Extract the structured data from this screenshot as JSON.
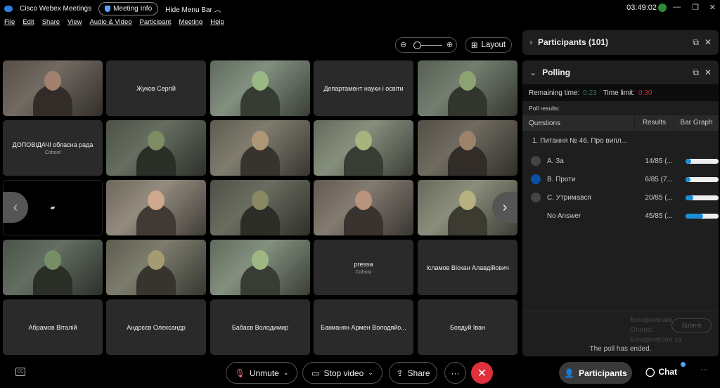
{
  "titlebar": {
    "app": "Cisco Webex Meetings",
    "meeting_info": "Meeting Info",
    "hide_menu": "Hide Menu Bar",
    "time": "03:49:02"
  },
  "menu": [
    "File",
    "Edit",
    "Share",
    "View",
    "Audio & Video",
    "Participant",
    "Meeting",
    "Help"
  ],
  "toolbar": {
    "layout": "Layout"
  },
  "tiles": [
    {
      "type": "video"
    },
    {
      "type": "name",
      "name": "Жуков Сергій"
    },
    {
      "type": "video"
    },
    {
      "type": "name",
      "name": "Департамент науки і освіти"
    },
    {
      "type": "video"
    },
    {
      "type": "name",
      "name": "ДОПОВІДАЧІ обласна рада",
      "sub": "Cohost"
    },
    {
      "type": "video"
    },
    {
      "type": "video"
    },
    {
      "type": "video"
    },
    {
      "type": "video"
    },
    {
      "type": "black"
    },
    {
      "type": "video"
    },
    {
      "type": "video"
    },
    {
      "type": "video"
    },
    {
      "type": "video"
    },
    {
      "type": "video"
    },
    {
      "type": "video"
    },
    {
      "type": "video"
    },
    {
      "type": "name",
      "name": "pressa",
      "sub": "Cohost"
    },
    {
      "type": "name",
      "name": "Ісламов Віскан Алавдійович"
    },
    {
      "type": "name",
      "name": "Абрамов Віталій"
    },
    {
      "type": "name",
      "name": "Андрєєв Олександр"
    },
    {
      "type": "name",
      "name": "Бабаєв Володимир"
    },
    {
      "type": "name",
      "name": "Бакманян Армен Володяйо..."
    },
    {
      "type": "name",
      "name": "Бовдуй Іван"
    }
  ],
  "participants_panel": {
    "title": "Participants (101)"
  },
  "polling": {
    "title": "Polling",
    "remaining_label": "Remaining time:",
    "remaining": "0:23",
    "limit_label": "Time limit:",
    "limit": "0:30",
    "results_label": "Poll results:",
    "col_questions": "Questions",
    "col_results": "Results",
    "col_bar": "Bar Graph",
    "question": "1.  Питання № 46.  Про випл...",
    "options": [
      {
        "label": "A.   За",
        "result": "14/85 (...",
        "fraction": 0.165,
        "selected": false,
        "radio": true
      },
      {
        "label": "B.   Проти",
        "result": "6/85 (7...",
        "fraction": 0.07,
        "selected": true,
        "radio": true
      },
      {
        "label": "C.   Утримався",
        "result": "20/85 (...",
        "fraction": 0.235,
        "selected": false,
        "radio": true
      },
      {
        "label": "No Answer",
        "result": "45/85 (...",
        "fraction": 0.53,
        "selected": false,
        "radio": false
      }
    ],
    "ghost_text": "Бочарникова Олена: Бочарникова за",
    "submit": "Submit",
    "ended": "The poll has ended."
  },
  "controls": {
    "unmute": "Unmute",
    "stop_video": "Stop video",
    "share": "Share",
    "participants": "Participants",
    "chat": "Chat",
    "cc": "CC"
  },
  "colors": {
    "accent": "#1a8fd6",
    "leave": "#e0303c",
    "remaining": "#2e7d4f",
    "limit": "#c62828"
  }
}
